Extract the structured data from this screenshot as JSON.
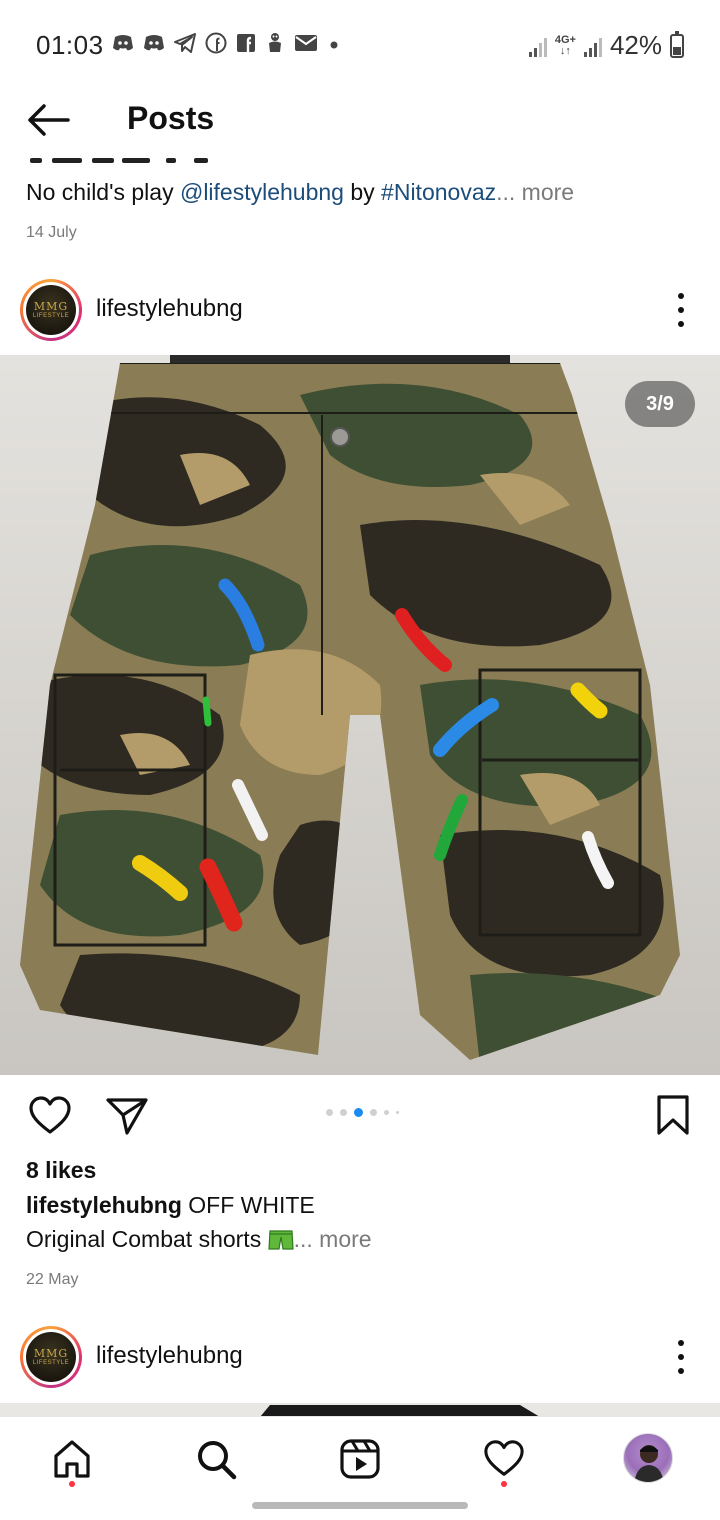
{
  "status_bar": {
    "time": "01:03",
    "battery": "42%",
    "battery_level": 0.42,
    "network_label": "4G+",
    "notification_icons": [
      "discord-icon",
      "discord-icon",
      "telegram-icon",
      "facebook-circle-icon",
      "facebook-square-icon",
      "android-icon",
      "mail-icon",
      "dot-icon"
    ]
  },
  "header": {
    "title": "Posts",
    "back_icon": "arrow-left-icon"
  },
  "previous_post": {
    "caption_text": "No child's play ",
    "mention": "@lifestylehubng",
    "by_text": " by ",
    "hashtag": "#Nitonovaz",
    "more": "... more",
    "date": "14 July"
  },
  "post": {
    "username": "lifestylehubng",
    "avatar_logo_text": "MMG",
    "avatar_logo_subtext": "LIFESTYLE",
    "counter": "3/9",
    "carousel_total": 9,
    "carousel_active": 3,
    "likes": "8 likes",
    "caption_user": "lifestylehubng",
    "caption_line1": " OFF WHITE",
    "caption_line2": "Original Combat shorts ",
    "caption_more": "... more",
    "date": "22 May"
  },
  "next_post": {
    "username": "lifestylehubng"
  },
  "bottom_nav": {
    "items": [
      "home-icon",
      "search-icon",
      "reels-icon",
      "activity-heart-icon",
      "profile-avatar"
    ]
  },
  "colors": {
    "link": "#1b4c7a",
    "muted": "#7a7a7a",
    "active_dot": "#1a8cf0",
    "notification": "#ff3040"
  }
}
